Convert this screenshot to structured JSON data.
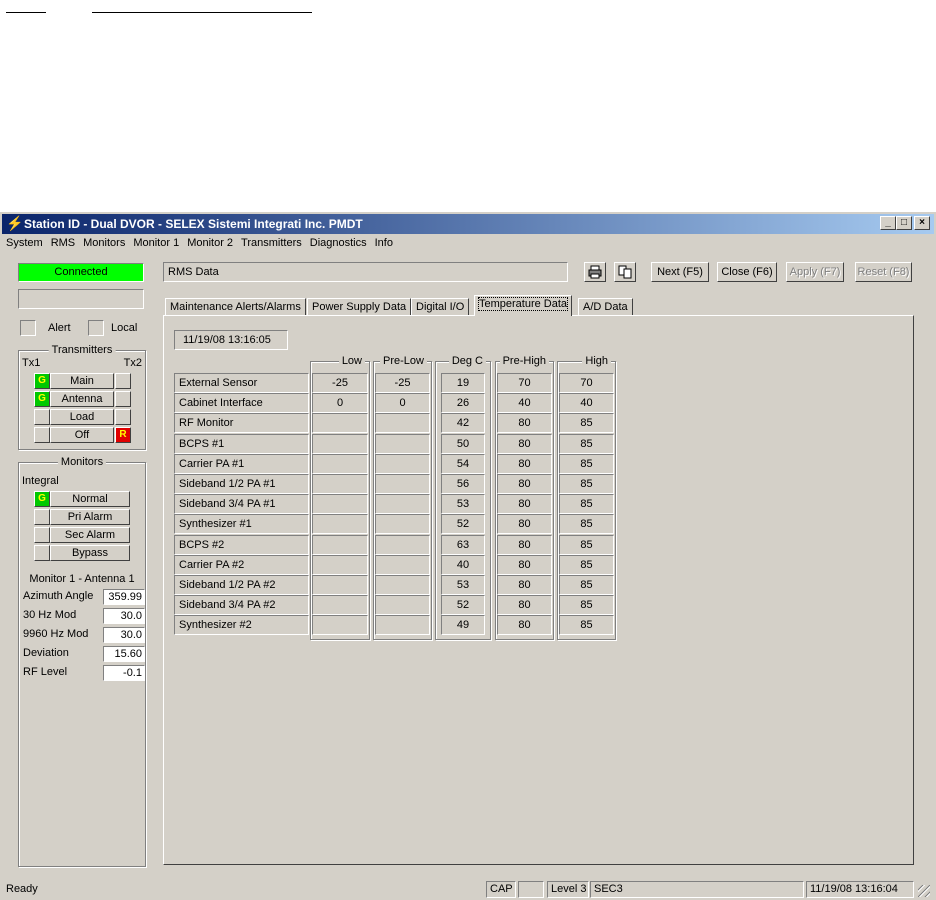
{
  "window": {
    "title": "Station ID - Dual DVOR - SELEX Sistemi Integrati Inc. PMDT",
    "app_icon": "lightning-icon",
    "controls": {
      "minimize": "_",
      "maximize": "□",
      "close": "×"
    }
  },
  "menu": [
    "System",
    "RMS",
    "Monitors",
    "Monitor 1",
    "Monitor 2",
    "Transmitters",
    "Diagnostics",
    "Info"
  ],
  "left_panel": {
    "connection": "Connected",
    "connection_color": "#00ff00",
    "alert_label": "Alert",
    "local_label": "Local",
    "transmitters": {
      "title": "Transmitters",
      "tx1": "Tx1",
      "tx2": "Tx2",
      "rows": [
        {
          "label": "Main",
          "left": "G",
          "right": ""
        },
        {
          "label": "Antenna",
          "left": "G",
          "right": ""
        },
        {
          "label": "Load",
          "left": "",
          "right": ""
        },
        {
          "label": "Off",
          "left": "",
          "right": "R"
        }
      ]
    },
    "monitors": {
      "title": "Monitors",
      "integral": "Integral",
      "rows": [
        {
          "label": "Normal",
          "ind": "G"
        },
        {
          "label": "Pri Alarm",
          "ind": ""
        },
        {
          "label": "Sec Alarm",
          "ind": ""
        },
        {
          "label": "Bypass",
          "ind": ""
        }
      ],
      "subtitle": "Monitor 1 - Antenna 1",
      "readouts": [
        {
          "label": "Azimuth Angle",
          "value": "359.99"
        },
        {
          "label": "30 Hz Mod",
          "value": "30.0"
        },
        {
          "label": "9960 Hz Mod",
          "value": "30.0"
        },
        {
          "label": "Deviation",
          "value": "15.60"
        },
        {
          "label": "RF Level",
          "value": "-0.1"
        }
      ]
    }
  },
  "header": {
    "title": "RMS Data",
    "print_icon": "printer-icon",
    "copy_icon": "copy-icon",
    "buttons": {
      "next": "Next (F5)",
      "close": "Close (F6)",
      "apply": "Apply (F7)",
      "reset": "Reset (F8)"
    }
  },
  "tabs": [
    "Maintenance Alerts/Alarms",
    "Power Supply Data",
    "Digital I/O",
    "Temperature Data",
    "A/D Data"
  ],
  "active_tab": "Temperature Data",
  "temperature": {
    "timestamp": "11/19/08 13:16:05",
    "columns": [
      "Low",
      "Pre-Low",
      "Deg C",
      "Pre-High",
      "High"
    ],
    "rows": [
      {
        "name": "External Sensor",
        "low": "-25",
        "prelow": "-25",
        "degc": "19",
        "prehigh": "70",
        "high": "70"
      },
      {
        "name": "Cabinet Interface",
        "low": "0",
        "prelow": "0",
        "degc": "26",
        "prehigh": "40",
        "high": "40"
      },
      {
        "name": "RF Monitor",
        "low": "",
        "prelow": "",
        "degc": "42",
        "prehigh": "80",
        "high": "85"
      },
      {
        "name": "BCPS #1",
        "low": "",
        "prelow": "",
        "degc": "50",
        "prehigh": "80",
        "high": "85"
      },
      {
        "name": "Carrier PA #1",
        "low": "",
        "prelow": "",
        "degc": "54",
        "prehigh": "80",
        "high": "85"
      },
      {
        "name": "Sideband 1/2 PA #1",
        "low": "",
        "prelow": "",
        "degc": "56",
        "prehigh": "80",
        "high": "85"
      },
      {
        "name": "Sideband 3/4 PA #1",
        "low": "",
        "prelow": "",
        "degc": "53",
        "prehigh": "80",
        "high": "85"
      },
      {
        "name": "Synthesizer #1",
        "low": "",
        "prelow": "",
        "degc": "52",
        "prehigh": "80",
        "high": "85"
      },
      {
        "name": "BCPS #2",
        "low": "",
        "prelow": "",
        "degc": "63",
        "prehigh": "80",
        "high": "85"
      },
      {
        "name": "Carrier PA #2",
        "low": "",
        "prelow": "",
        "degc": "40",
        "prehigh": "80",
        "high": "85"
      },
      {
        "name": "Sideband 1/2 PA #2",
        "low": "",
        "prelow": "",
        "degc": "53",
        "prehigh": "80",
        "high": "85"
      },
      {
        "name": "Sideband 3/4 PA #2",
        "low": "",
        "prelow": "",
        "degc": "52",
        "prehigh": "80",
        "high": "85"
      },
      {
        "name": "Synthesizer #2",
        "low": "",
        "prelow": "",
        "degc": "49",
        "prehigh": "80",
        "high": "85"
      }
    ]
  },
  "status_bar": {
    "message": "Ready",
    "cap": "CAP",
    "num": "",
    "level": "Level 3",
    "sec": "SEC3",
    "datetime": "11/19/08 13:16:04"
  }
}
